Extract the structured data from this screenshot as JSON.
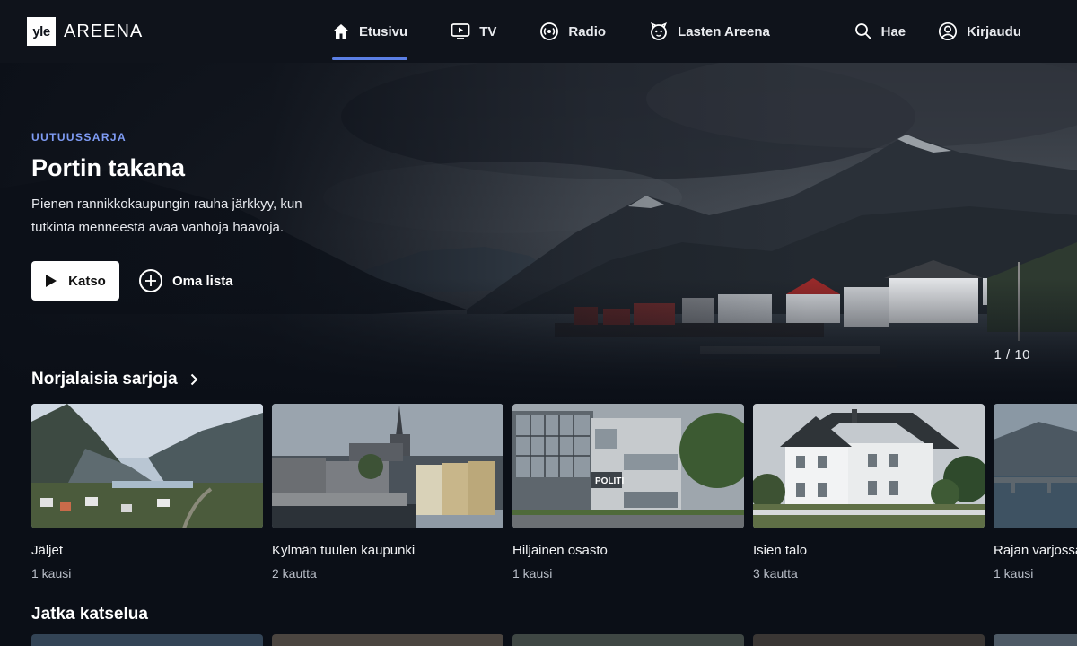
{
  "header": {
    "logo_box": "yle",
    "logo_text": "AREENA",
    "nav": [
      {
        "label": "Etusivu",
        "icon": "home-icon",
        "active": true
      },
      {
        "label": "TV",
        "icon": "tv-icon"
      },
      {
        "label": "Radio",
        "icon": "radio-icon"
      },
      {
        "label": "Lasten Areena",
        "icon": "kids-icon"
      }
    ],
    "search_label": "Hae",
    "login_label": "Kirjaudu"
  },
  "hero": {
    "eyebrow": "UUTUUSSARJA",
    "title": "Portin takana",
    "description": "Pienen rannikkokaupungin rauha järkkyy, kun tutkinta menneestä avaa vanhoja haavoja.",
    "play_label": "Katso",
    "list_label": "Oma lista",
    "pager": "1 / 10"
  },
  "sections": {
    "norwegian": {
      "title": "Norjalaisia sarjoja",
      "items": [
        {
          "title": "Jäljet",
          "sub": "1 kausi"
        },
        {
          "title": "Kylmän tuulen kaupunki",
          "sub": "2 kautta"
        },
        {
          "title": "Hiljainen osasto",
          "sub": "1 kausi"
        },
        {
          "title": "Isien talo",
          "sub": "3 kautta"
        },
        {
          "title": "Rajan varjossa",
          "sub": "1 kausi"
        }
      ]
    },
    "continue": {
      "title": "Jatka katselua"
    }
  },
  "police_sign": "POLITI",
  "colors": {
    "accent": "#5b7fe5",
    "eyebrow": "#7f9cf5",
    "background": "#0b0f17"
  }
}
